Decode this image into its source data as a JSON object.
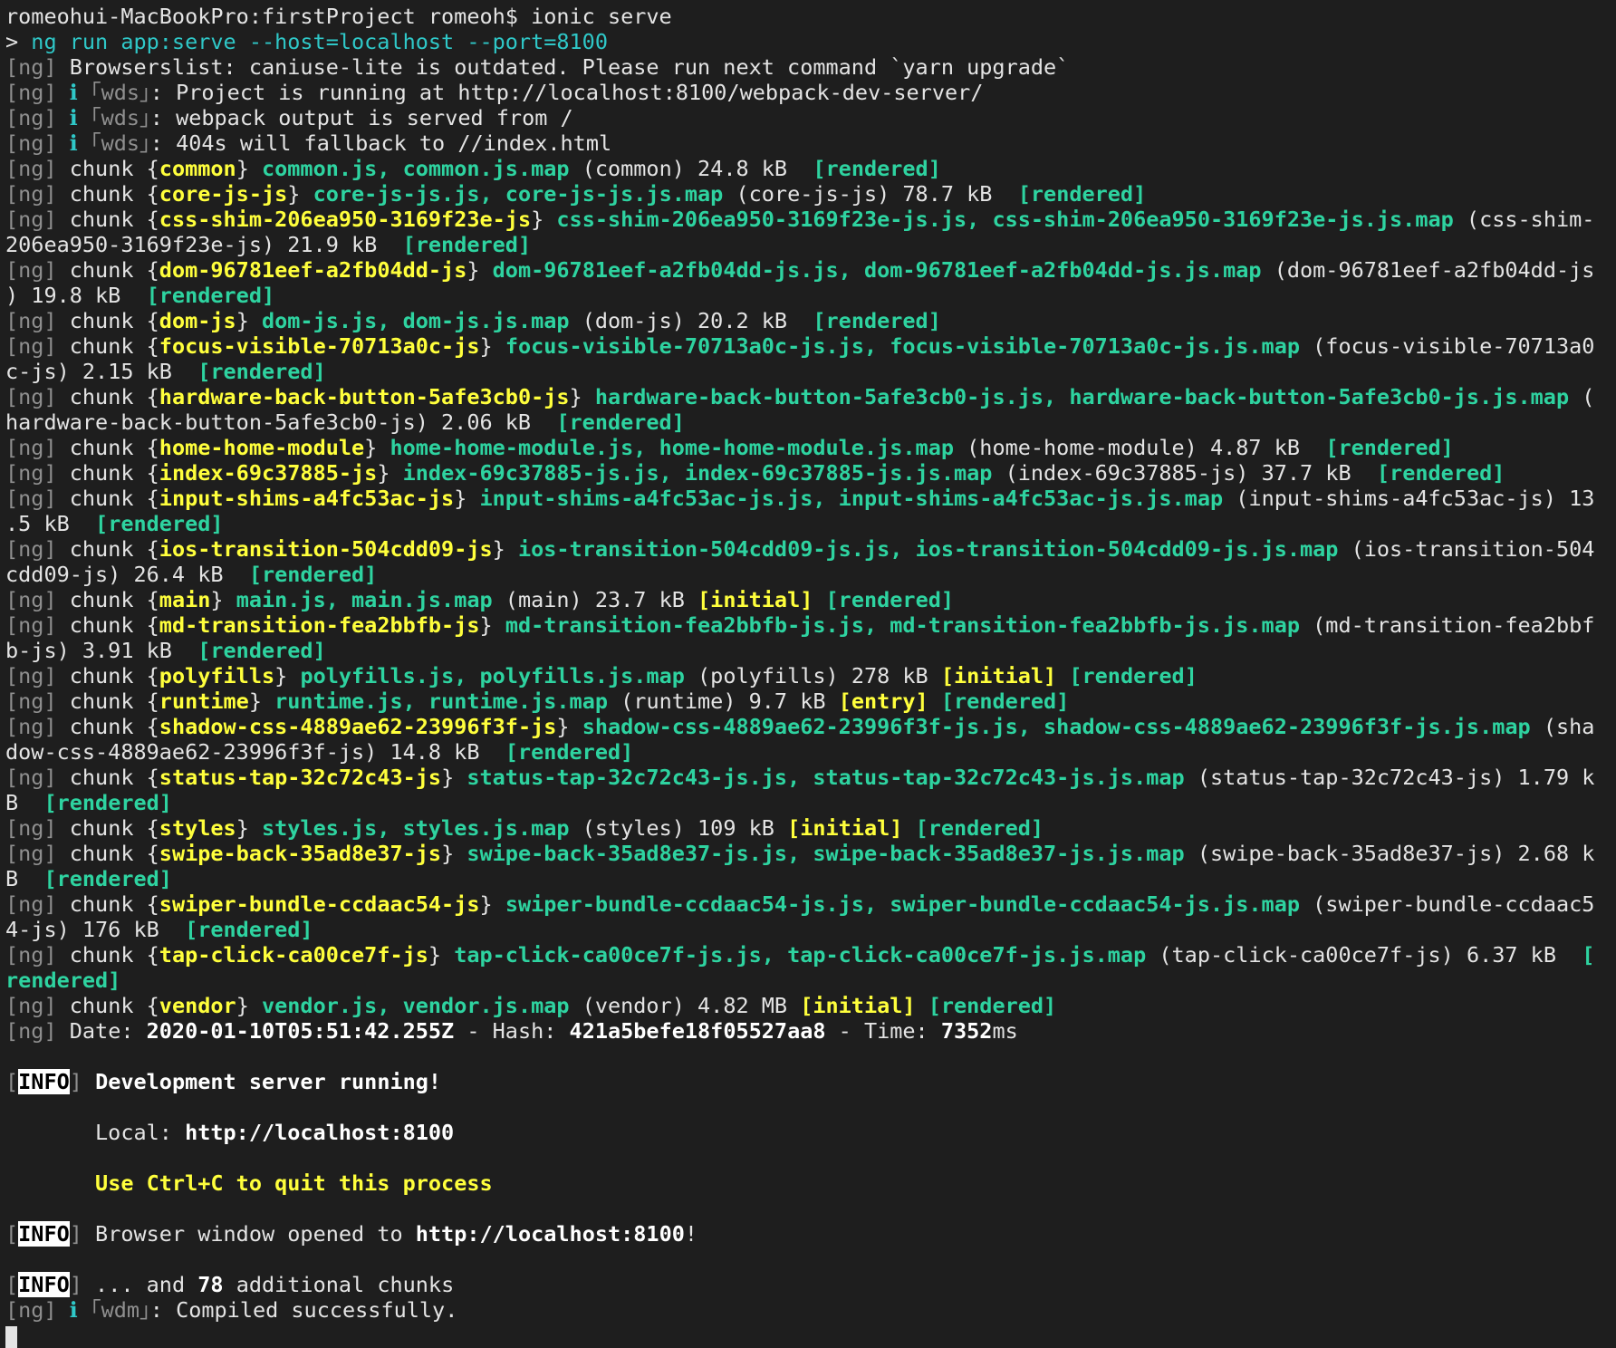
{
  "terminal": {
    "colors": {
      "background": "#1e1e1e",
      "text": "#e4e4e4",
      "dim": "#8f8f8f",
      "cyan": "#2fc8c8",
      "green": "#2ed3a0",
      "yellow": "#ffff3c"
    },
    "lines": [
      [
        [
          "plain",
          "romeohui-MacBookPro:firstProject romeoh$ ionic serve"
        ]
      ],
      [
        [
          "plain",
          "> "
        ],
        [
          "cy",
          "ng run app:serve --host=localhost --port=8100"
        ]
      ],
      [
        [
          "dim",
          "[ng] "
        ],
        [
          "plain",
          "Browserslist: caniuse-lite is outdated. Please run next command `yarn upgrade`"
        ]
      ],
      [
        [
          "dim",
          "[ng] "
        ],
        [
          "cy",
          "ℹ "
        ],
        [
          "dim",
          "｢wds｣"
        ],
        [
          "plain",
          ": Project is running at http://localhost:8100/webpack-dev-server/"
        ]
      ],
      [
        [
          "dim",
          "[ng] "
        ],
        [
          "cy",
          "ℹ "
        ],
        [
          "dim",
          "｢wds｣"
        ],
        [
          "plain",
          ": webpack output is served from /"
        ]
      ],
      [
        [
          "dim",
          "[ng] "
        ],
        [
          "cy",
          "ℹ "
        ],
        [
          "dim",
          "｢wds｣"
        ],
        [
          "plain",
          ": 404s will fallback to //index.html"
        ]
      ],
      [
        [
          "dim",
          "[ng] "
        ],
        [
          "plain",
          "chunk {"
        ],
        [
          "yl",
          "common"
        ],
        [
          "plain",
          "} "
        ],
        [
          "gr",
          "common.js, common.js.map"
        ],
        [
          "plain",
          " (common) 24.8 kB  "
        ],
        [
          "gr",
          "[rendered]"
        ]
      ],
      [
        [
          "dim",
          "[ng] "
        ],
        [
          "plain",
          "chunk {"
        ],
        [
          "yl",
          "core-js-js"
        ],
        [
          "plain",
          "} "
        ],
        [
          "gr",
          "core-js-js.js, core-js-js.js.map"
        ],
        [
          "plain",
          " (core-js-js) 78.7 kB  "
        ],
        [
          "gr",
          "[rendered]"
        ]
      ],
      [
        [
          "dim",
          "[ng] "
        ],
        [
          "plain",
          "chunk {"
        ],
        [
          "yl",
          "css-shim-206ea950-3169f23e-js"
        ],
        [
          "plain",
          "} "
        ],
        [
          "gr",
          "css-shim-206ea950-3169f23e-js.js, css-shim-206ea950-3169f23e-js.js.map"
        ],
        [
          "plain",
          " (css-shim-"
        ]
      ],
      [
        [
          "plain",
          "206ea950-3169f23e-js) 21.9 kB  "
        ],
        [
          "gr",
          "[rendered]"
        ]
      ],
      [
        [
          "dim",
          "[ng] "
        ],
        [
          "plain",
          "chunk {"
        ],
        [
          "yl",
          "dom-96781eef-a2fb04dd-js"
        ],
        [
          "plain",
          "} "
        ],
        [
          "gr",
          "dom-96781eef-a2fb04dd-js.js, dom-96781eef-a2fb04dd-js.js.map"
        ],
        [
          "plain",
          " (dom-96781eef-a2fb04dd-js"
        ]
      ],
      [
        [
          "plain",
          ") 19.8 kB  "
        ],
        [
          "gr",
          "[rendered]"
        ]
      ],
      [
        [
          "dim",
          "[ng] "
        ],
        [
          "plain",
          "chunk {"
        ],
        [
          "yl",
          "dom-js"
        ],
        [
          "plain",
          "} "
        ],
        [
          "gr",
          "dom-js.js, dom-js.js.map"
        ],
        [
          "plain",
          " (dom-js) 20.2 kB  "
        ],
        [
          "gr",
          "[rendered]"
        ]
      ],
      [
        [
          "dim",
          "[ng] "
        ],
        [
          "plain",
          "chunk {"
        ],
        [
          "yl",
          "focus-visible-70713a0c-js"
        ],
        [
          "plain",
          "} "
        ],
        [
          "gr",
          "focus-visible-70713a0c-js.js, focus-visible-70713a0c-js.js.map"
        ],
        [
          "plain",
          " (focus-visible-70713a0"
        ]
      ],
      [
        [
          "plain",
          "c-js) 2.15 kB  "
        ],
        [
          "gr",
          "[rendered]"
        ]
      ],
      [
        [
          "dim",
          "[ng] "
        ],
        [
          "plain",
          "chunk {"
        ],
        [
          "yl",
          "hardware-back-button-5afe3cb0-js"
        ],
        [
          "plain",
          "} "
        ],
        [
          "gr",
          "hardware-back-button-5afe3cb0-js.js, hardware-back-button-5afe3cb0-js.js.map"
        ],
        [
          "plain",
          " ("
        ]
      ],
      [
        [
          "plain",
          "hardware-back-button-5afe3cb0-js) 2.06 kB  "
        ],
        [
          "gr",
          "[rendered]"
        ]
      ],
      [
        [
          "dim",
          "[ng] "
        ],
        [
          "plain",
          "chunk {"
        ],
        [
          "yl",
          "home-home-module"
        ],
        [
          "plain",
          "} "
        ],
        [
          "gr",
          "home-home-module.js, home-home-module.js.map"
        ],
        [
          "plain",
          " (home-home-module) 4.87 kB  "
        ],
        [
          "gr",
          "[rendered]"
        ]
      ],
      [
        [
          "dim",
          "[ng] "
        ],
        [
          "plain",
          "chunk {"
        ],
        [
          "yl",
          "index-69c37885-js"
        ],
        [
          "plain",
          "} "
        ],
        [
          "gr",
          "index-69c37885-js.js, index-69c37885-js.js.map"
        ],
        [
          "plain",
          " (index-69c37885-js) 37.7 kB  "
        ],
        [
          "gr",
          "[rendered]"
        ]
      ],
      [
        [
          "dim",
          "[ng] "
        ],
        [
          "plain",
          "chunk {"
        ],
        [
          "yl",
          "input-shims-a4fc53ac-js"
        ],
        [
          "plain",
          "} "
        ],
        [
          "gr",
          "input-shims-a4fc53ac-js.js, input-shims-a4fc53ac-js.js.map"
        ],
        [
          "plain",
          " (input-shims-a4fc53ac-js) 13"
        ]
      ],
      [
        [
          "plain",
          ".5 kB  "
        ],
        [
          "gr",
          "[rendered]"
        ]
      ],
      [
        [
          "dim",
          "[ng] "
        ],
        [
          "plain",
          "chunk {"
        ],
        [
          "yl",
          "ios-transition-504cdd09-js"
        ],
        [
          "plain",
          "} "
        ],
        [
          "gr",
          "ios-transition-504cdd09-js.js, ios-transition-504cdd09-js.js.map"
        ],
        [
          "plain",
          " (ios-transition-504"
        ]
      ],
      [
        [
          "plain",
          "cdd09-js) 26.4 kB  "
        ],
        [
          "gr",
          "[rendered]"
        ]
      ],
      [
        [
          "dim",
          "[ng] "
        ],
        [
          "plain",
          "chunk {"
        ],
        [
          "yl",
          "main"
        ],
        [
          "plain",
          "} "
        ],
        [
          "gr",
          "main.js, main.js.map"
        ],
        [
          "plain",
          " (main) 23.7 kB "
        ],
        [
          "yl",
          "[initial]"
        ],
        [
          "plain",
          " "
        ],
        [
          "gr",
          "[rendered]"
        ]
      ],
      [
        [
          "dim",
          "[ng] "
        ],
        [
          "plain",
          "chunk {"
        ],
        [
          "yl",
          "md-transition-fea2bbfb-js"
        ],
        [
          "plain",
          "} "
        ],
        [
          "gr",
          "md-transition-fea2bbfb-js.js, md-transition-fea2bbfb-js.js.map"
        ],
        [
          "plain",
          " (md-transition-fea2bbf"
        ]
      ],
      [
        [
          "plain",
          "b-js) 3.91 kB  "
        ],
        [
          "gr",
          "[rendered]"
        ]
      ],
      [
        [
          "dim",
          "[ng] "
        ],
        [
          "plain",
          "chunk {"
        ],
        [
          "yl",
          "polyfills"
        ],
        [
          "plain",
          "} "
        ],
        [
          "gr",
          "polyfills.js, polyfills.js.map"
        ],
        [
          "plain",
          " (polyfills) 278 kB "
        ],
        [
          "yl",
          "[initial]"
        ],
        [
          "plain",
          " "
        ],
        [
          "gr",
          "[rendered]"
        ]
      ],
      [
        [
          "dim",
          "[ng] "
        ],
        [
          "plain",
          "chunk {"
        ],
        [
          "yl",
          "runtime"
        ],
        [
          "plain",
          "} "
        ],
        [
          "gr",
          "runtime.js, runtime.js.map"
        ],
        [
          "plain",
          " (runtime) 9.7 kB "
        ],
        [
          "yl",
          "[entry]"
        ],
        [
          "plain",
          " "
        ],
        [
          "gr",
          "[rendered]"
        ]
      ],
      [
        [
          "dim",
          "[ng] "
        ],
        [
          "plain",
          "chunk {"
        ],
        [
          "yl",
          "shadow-css-4889ae62-23996f3f-js"
        ],
        [
          "plain",
          "} "
        ],
        [
          "gr",
          "shadow-css-4889ae62-23996f3f-js.js, shadow-css-4889ae62-23996f3f-js.js.map"
        ],
        [
          "plain",
          " (sha"
        ]
      ],
      [
        [
          "plain",
          "dow-css-4889ae62-23996f3f-js) 14.8 kB  "
        ],
        [
          "gr",
          "[rendered]"
        ]
      ],
      [
        [
          "dim",
          "[ng] "
        ],
        [
          "plain",
          "chunk {"
        ],
        [
          "yl",
          "status-tap-32c72c43-js"
        ],
        [
          "plain",
          "} "
        ],
        [
          "gr",
          "status-tap-32c72c43-js.js, status-tap-32c72c43-js.js.map"
        ],
        [
          "plain",
          " (status-tap-32c72c43-js) 1.79 k"
        ]
      ],
      [
        [
          "plain",
          "B  "
        ],
        [
          "gr",
          "[rendered]"
        ]
      ],
      [
        [
          "dim",
          "[ng] "
        ],
        [
          "plain",
          "chunk {"
        ],
        [
          "yl",
          "styles"
        ],
        [
          "plain",
          "} "
        ],
        [
          "gr",
          "styles.js, styles.js.map"
        ],
        [
          "plain",
          " (styles) 109 kB "
        ],
        [
          "yl",
          "[initial]"
        ],
        [
          "plain",
          " "
        ],
        [
          "gr",
          "[rendered]"
        ]
      ],
      [
        [
          "dim",
          "[ng] "
        ],
        [
          "plain",
          "chunk {"
        ],
        [
          "yl",
          "swipe-back-35ad8e37-js"
        ],
        [
          "plain",
          "} "
        ],
        [
          "gr",
          "swipe-back-35ad8e37-js.js, swipe-back-35ad8e37-js.js.map"
        ],
        [
          "plain",
          " (swipe-back-35ad8e37-js) 2.68 k"
        ]
      ],
      [
        [
          "plain",
          "B  "
        ],
        [
          "gr",
          "[rendered]"
        ]
      ],
      [
        [
          "dim",
          "[ng] "
        ],
        [
          "plain",
          "chunk {"
        ],
        [
          "yl",
          "swiper-bundle-ccdaac54-js"
        ],
        [
          "plain",
          "} "
        ],
        [
          "gr",
          "swiper-bundle-ccdaac54-js.js, swiper-bundle-ccdaac54-js.js.map"
        ],
        [
          "plain",
          " (swiper-bundle-ccdaac5"
        ]
      ],
      [
        [
          "plain",
          "4-js) 176 kB  "
        ],
        [
          "gr",
          "[rendered]"
        ]
      ],
      [
        [
          "dim",
          "[ng] "
        ],
        [
          "plain",
          "chunk {"
        ],
        [
          "yl",
          "tap-click-ca00ce7f-js"
        ],
        [
          "plain",
          "} "
        ],
        [
          "gr",
          "tap-click-ca00ce7f-js.js, tap-click-ca00ce7f-js.js.map"
        ],
        [
          "plain",
          " (tap-click-ca00ce7f-js) 6.37 kB  "
        ],
        [
          "gr",
          "["
        ]
      ],
      [
        [
          "gr",
          "rendered]"
        ]
      ],
      [
        [
          "dim",
          "[ng] "
        ],
        [
          "plain",
          "chunk {"
        ],
        [
          "yl",
          "vendor"
        ],
        [
          "plain",
          "} "
        ],
        [
          "gr",
          "vendor.js, vendor.js.map"
        ],
        [
          "plain",
          " (vendor) 4.82 MB "
        ],
        [
          "yl",
          "[initial]"
        ],
        [
          "plain",
          " "
        ],
        [
          "gr",
          "[rendered]"
        ]
      ],
      [
        [
          "dim",
          "[ng] "
        ],
        [
          "plain",
          "Date: "
        ],
        [
          "wb",
          "2020-01-10T05:51:42.255Z"
        ],
        [
          "plain",
          " - Hash: "
        ],
        [
          "wb",
          "421a5befe18f05527aa8"
        ],
        [
          "plain",
          " - Time: "
        ],
        [
          "wb",
          "7352"
        ],
        [
          "plain",
          "ms"
        ]
      ],
      [],
      [
        [
          "dim",
          "["
        ],
        [
          "info-tag",
          "INFO"
        ],
        [
          "dim",
          "]"
        ],
        [
          "plain",
          " "
        ],
        [
          "wb",
          "Development server running!"
        ]
      ],
      [],
      [
        [
          "plain",
          "       Local: "
        ],
        [
          "wb",
          "http://localhost:8100"
        ]
      ],
      [],
      [
        [
          "plain",
          "       "
        ],
        [
          "yl",
          "Use Ctrl+C to quit this process"
        ]
      ],
      [],
      [
        [
          "dim",
          "["
        ],
        [
          "info-tag",
          "INFO"
        ],
        [
          "dim",
          "]"
        ],
        [
          "plain",
          " Browser window opened to "
        ],
        [
          "wb",
          "http://localhost:8100"
        ],
        [
          "plain",
          "!"
        ]
      ],
      [],
      [
        [
          "dim",
          "["
        ],
        [
          "info-tag",
          "INFO"
        ],
        [
          "dim",
          "]"
        ],
        [
          "plain",
          " ... and "
        ],
        [
          "wb",
          "78"
        ],
        [
          "plain",
          " additional chunks"
        ]
      ],
      [
        [
          "dim",
          "[ng] "
        ],
        [
          "cy",
          "ℹ "
        ],
        [
          "dim",
          "｢wdm｣"
        ],
        [
          "plain",
          ": Compiled successfully."
        ]
      ]
    ]
  }
}
